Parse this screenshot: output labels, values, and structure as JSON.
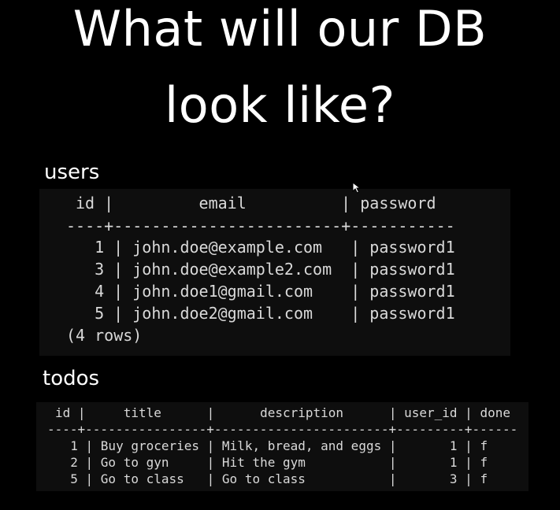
{
  "slide": {
    "title_line1": "What will our DB",
    "title_line2": "look like?"
  },
  "users": {
    "label": "users",
    "header": "id |         email          | password",
    "separator": "----+------------------------+-----------",
    "rows": [
      "  1 | john.doe@example.com   | password1",
      "  3 | john.doe@example2.com  | password1",
      "  4 | john.doe1@gmail.com    | password1",
      "  5 | john.doe2@gmail.com    | password1"
    ],
    "footer": "(4 rows)"
  },
  "todos": {
    "label": "todos",
    "header": "id |     title      |      description      | user_id | done",
    "separator": "----+----------------+-----------------------+---------+------",
    "rows": [
      "  1 | Buy groceries | Milk, bread, and eggs |       1 | f",
      "  2 | Go to gyn     | Hit the gym           |       1 | f",
      "  5 | Go to class   | Go to class           |       3 | f"
    ]
  },
  "colors": {
    "background": "#000000",
    "terminal_bg": "#0e0e0e",
    "terminal_text": "#d9d9d9",
    "title_text": "#ffffff"
  },
  "icons": {
    "cursor": "mouse-pointer-icon"
  }
}
